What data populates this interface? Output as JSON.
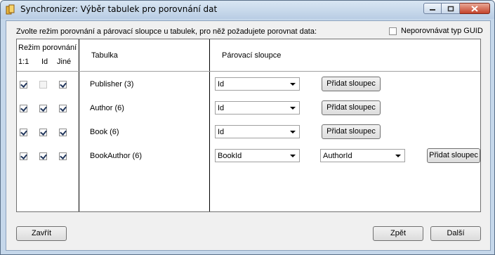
{
  "window": {
    "title": "Synchronizer: Výběr tabulek pro porovnání dat",
    "controls": {
      "minimize": "minimize",
      "maximize": "maximize",
      "close": "close"
    }
  },
  "instruction": "Zvolte režim porovnání a párovací sloupce u tabulek, pro něž požadujete porovnat data:",
  "guid_option": {
    "label": "Neporovnávat typ GUID",
    "checked": false
  },
  "table_header": {
    "mode_title": "Režim porovnání",
    "mode_cols": [
      "1:1",
      "Id",
      "Jiné"
    ],
    "table_col": "Tabulka",
    "pair_col": "Párovací sloupce"
  },
  "rows": [
    {
      "table": "Publisher (3)",
      "modes": [
        true,
        false,
        true
      ],
      "mode_id_disabled": true,
      "columns": [
        "Id"
      ],
      "add_label": "Přidat sloupec"
    },
    {
      "table": "Author (6)",
      "modes": [
        true,
        true,
        true
      ],
      "mode_id_disabled": false,
      "columns": [
        "Id"
      ],
      "add_label": "Přidat sloupec"
    },
    {
      "table": "Book (6)",
      "modes": [
        true,
        true,
        true
      ],
      "mode_id_disabled": false,
      "columns": [
        "Id"
      ],
      "add_label": "Přidat sloupec"
    },
    {
      "table": "BookAuthor (6)",
      "modes": [
        true,
        true,
        true
      ],
      "mode_id_disabled": false,
      "columns": [
        "BookId",
        "AuthorId"
      ],
      "add_label": "Přidat sloupec"
    }
  ],
  "footer": {
    "close_label": "Zavřít",
    "back_label": "Zpět",
    "next_label": "Další"
  },
  "colors": {
    "frame": "#c5d7ea",
    "client": "#f0f0f0",
    "close_button": "#c4432b"
  }
}
